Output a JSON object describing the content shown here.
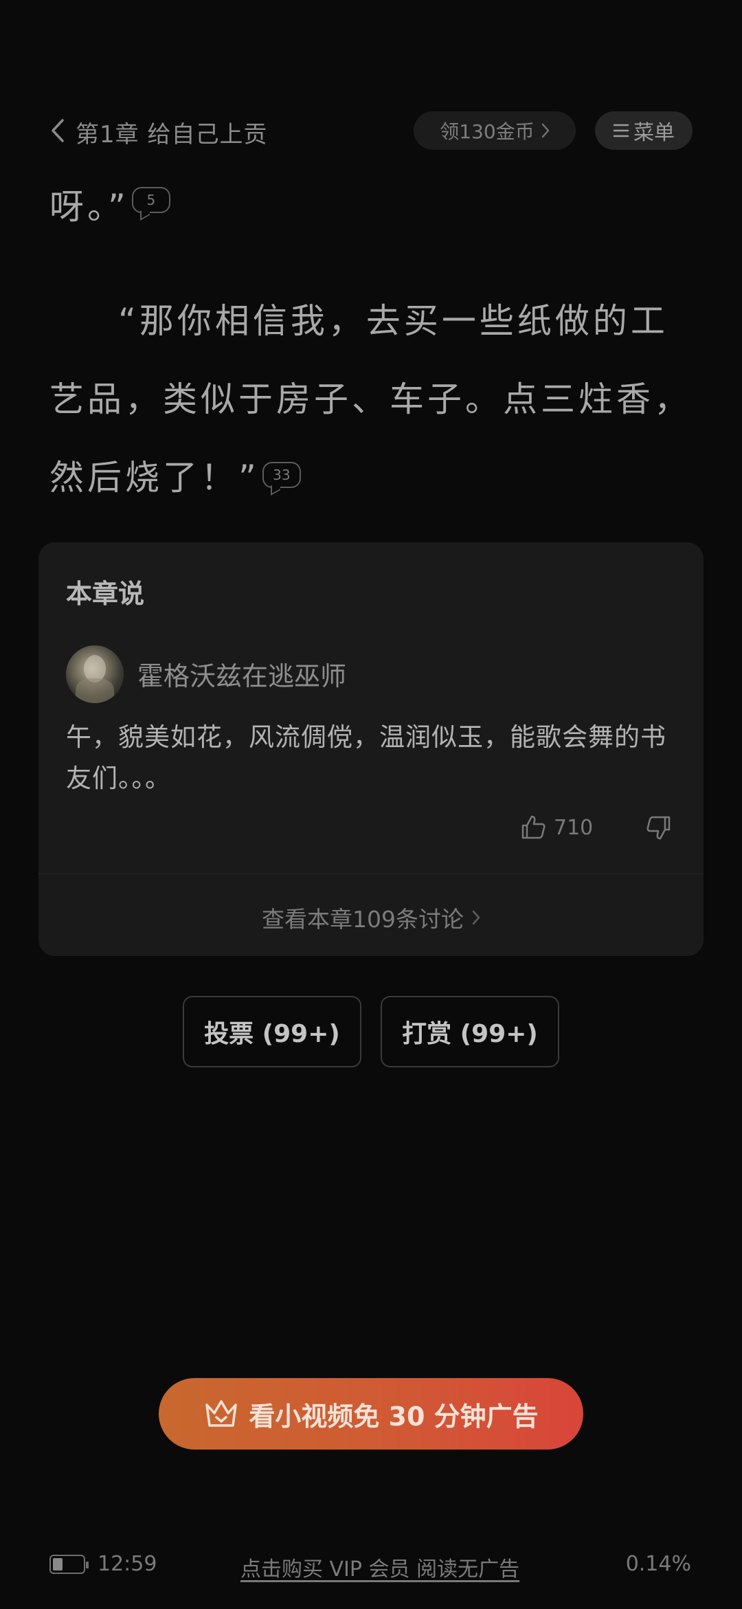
{
  "header": {
    "chapter_title": "第1章  给自己上贡",
    "coins_label": "领130金币",
    "menu_label": "菜单"
  },
  "reader": {
    "paragraph1_text": "呀。”",
    "paragraph1_comment_count": "5",
    "paragraph2_text": "“那你相信我，去买一些纸做的工艺品，类似于房子、车子。点三炷香，然后烧了！”",
    "paragraph2_comment_count": "33"
  },
  "chapter_card": {
    "title": "本章说",
    "username": "霍格沃兹在逃巫师",
    "comment": "午，貌美如花，风流倜傥，温润似玉，能歌会舞的书友们。。。",
    "like_count": "710",
    "discuss_label": "查看本章109条讨论"
  },
  "actions": {
    "vote_label": "投票 (99+)",
    "reward_label": "打赏 (99+)"
  },
  "ad": {
    "label": "看小视频免 30 分钟广告"
  },
  "footer": {
    "time": "12:59",
    "vip_link": "点击购买 VIP 会员 阅读无广告",
    "progress": "0.14%"
  },
  "icons": {
    "back": "chevron-left-icon",
    "coins_arrow": "chevron-right-icon",
    "menu": "menu-lines-icon",
    "like": "thumbs-up-icon",
    "dislike": "thumbs-down-icon",
    "crown": "crown-icon",
    "battery": "battery-icon"
  },
  "colors": {
    "background": "#0a0a0a",
    "card": "#1a1a1a",
    "ad_start": "#c8682e",
    "ad_end": "#d9453a"
  }
}
